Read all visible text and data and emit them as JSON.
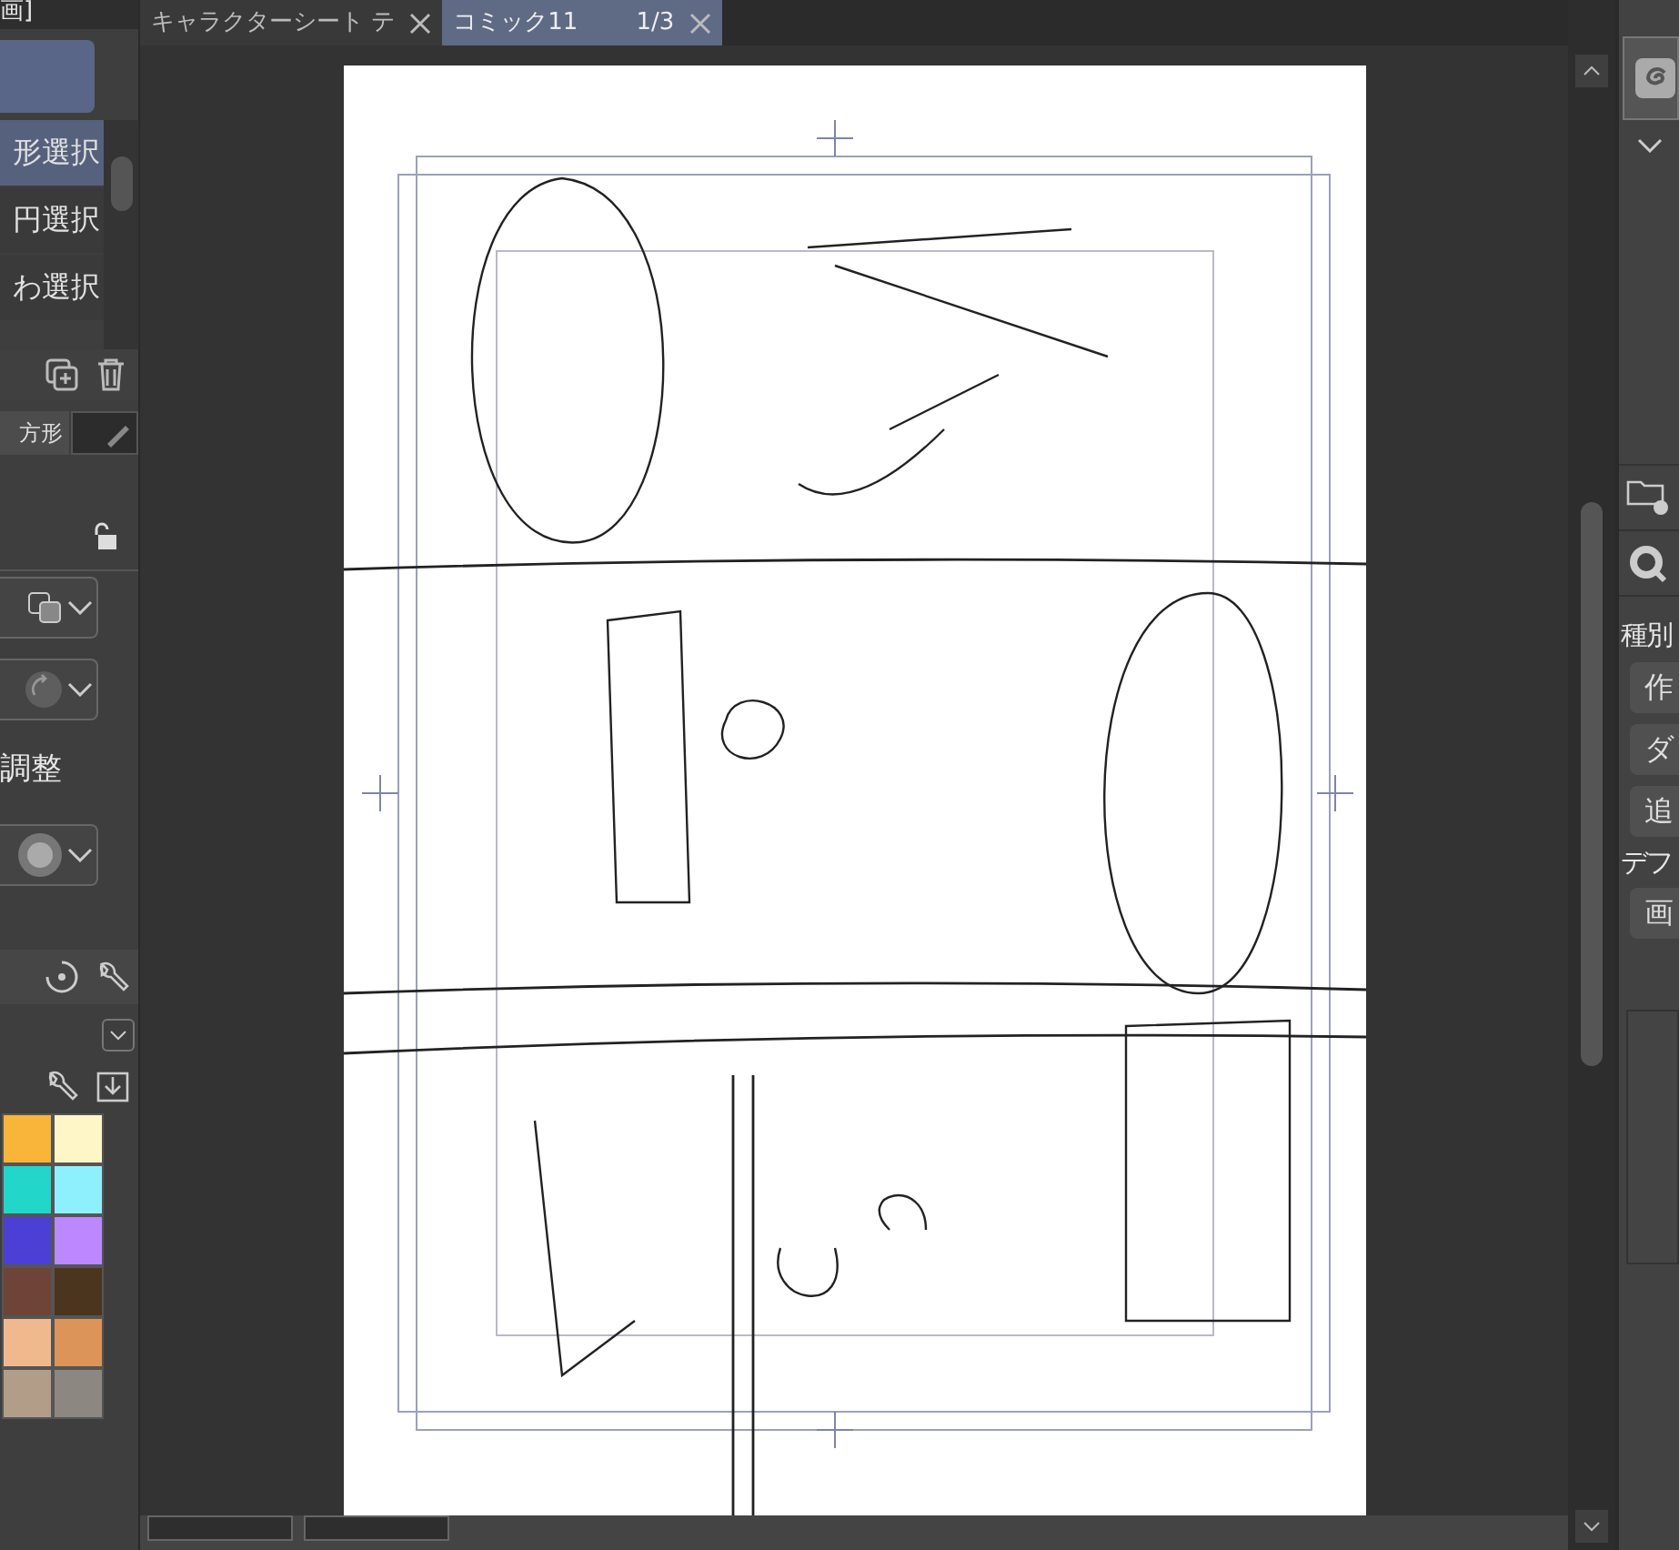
{
  "left_panel": {
    "header": "画]",
    "tool_list": [
      {
        "label": "形選択",
        "selected": true
      },
      {
        "label": "円選択",
        "selected": false
      },
      {
        "label": "わ選択",
        "selected": false
      }
    ],
    "tabs": [
      {
        "label": "方形",
        "kind": "text",
        "selected": true
      },
      {
        "kind": "pen",
        "selected": false
      }
    ],
    "adjust_label": "調整",
    "swatches": [
      {
        "color": "#f9b53a"
      },
      {
        "color": "#fff6c8"
      },
      {
        "color": "#22d6c9"
      },
      {
        "color": "#8ff0fd"
      },
      {
        "color": "#4b3fd6"
      },
      {
        "color": "#bb88ff"
      },
      {
        "color": "#6e4438"
      },
      {
        "color": "#4b351f"
      },
      {
        "color": "#f0b98d"
      },
      {
        "color": "#dc9458"
      },
      {
        "color": "#b29e88"
      },
      {
        "color": "#8d8781"
      }
    ]
  },
  "document_tabs": [
    {
      "title": "キャラクターシート テ",
      "selected": false
    },
    {
      "title": "コミック11",
      "page": "1/3",
      "selected": true
    }
  ],
  "right_panel": {
    "label": "種別",
    "buttons": [
      "作",
      "ダ",
      "追"
    ],
    "default_label": "デフ",
    "default_button": "画"
  }
}
